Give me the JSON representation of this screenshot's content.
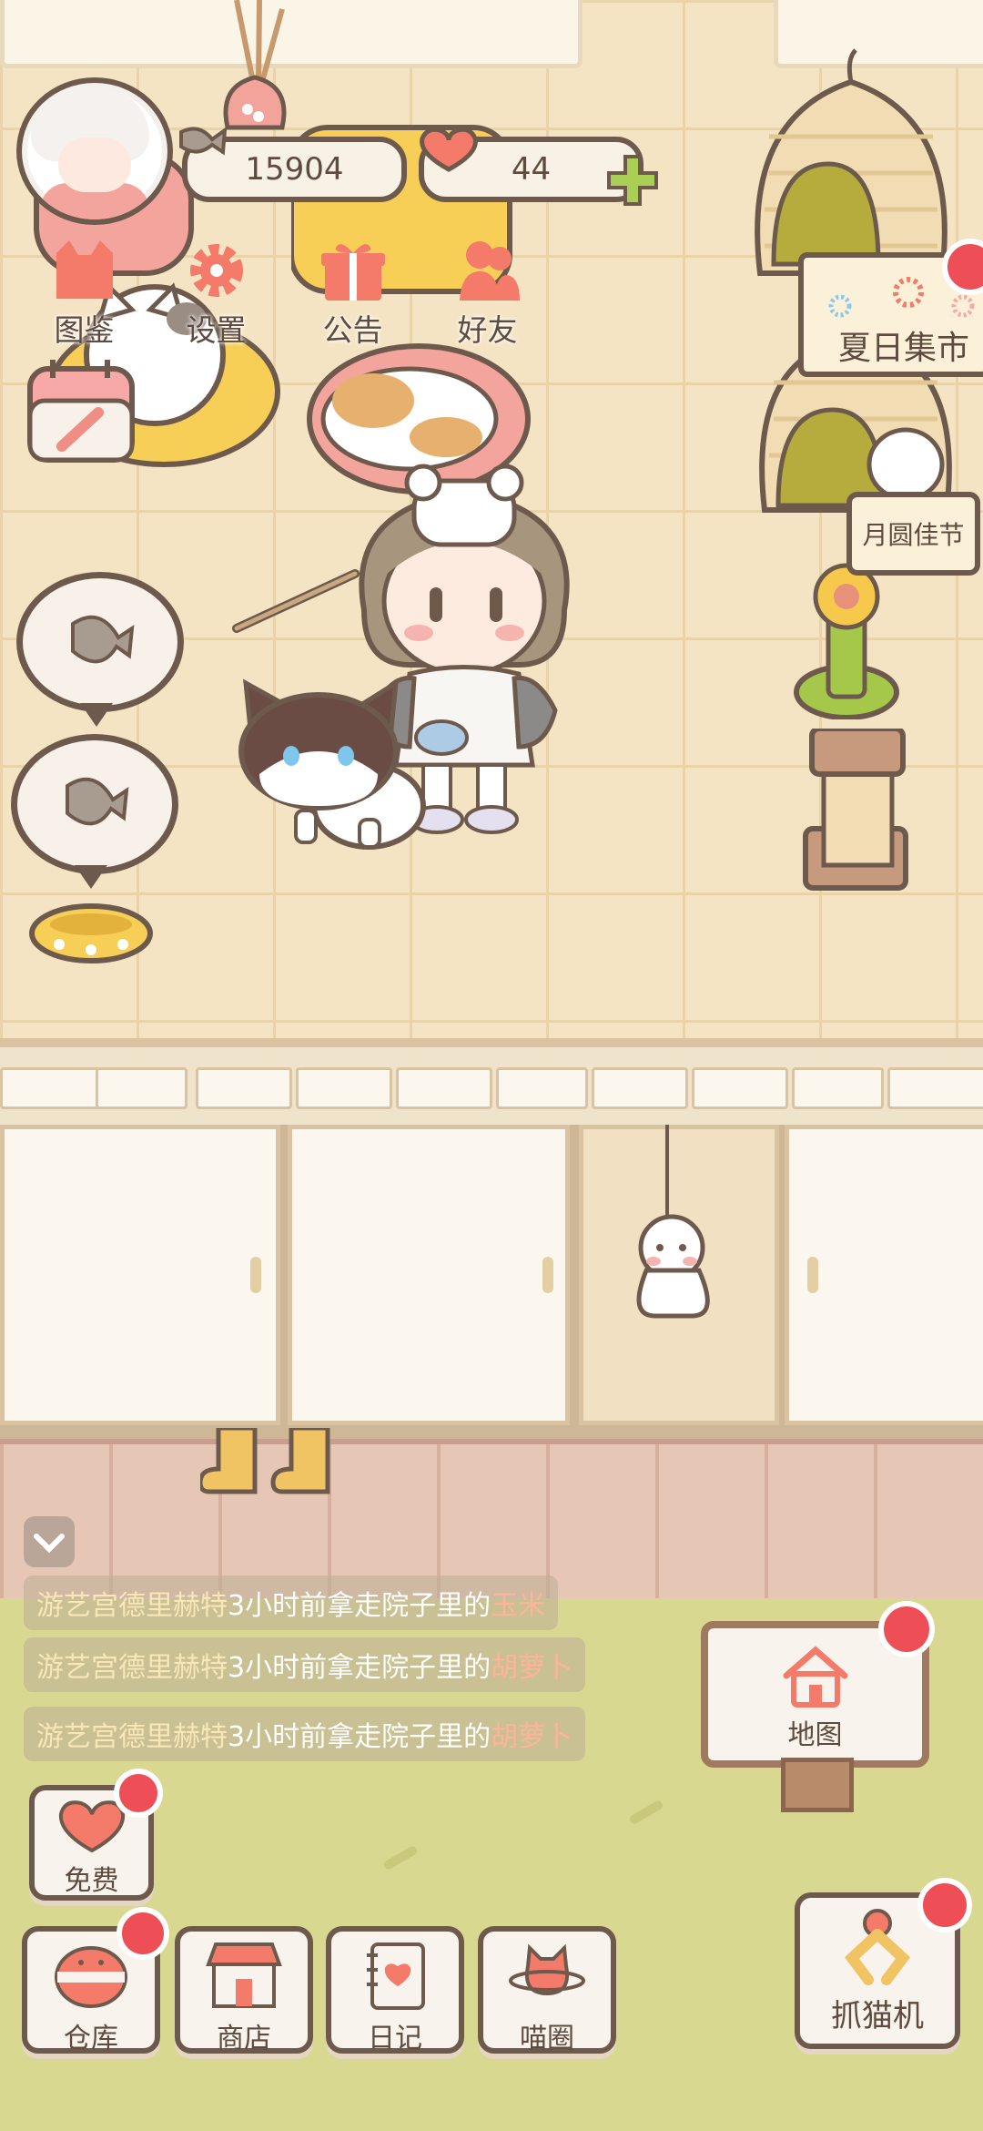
{
  "hud": {
    "fish_count": "15904",
    "heart_count": "44",
    "menu": [
      {
        "label": "图鉴",
        "icon": "cat-book-icon"
      },
      {
        "label": "设置",
        "icon": "gear-icon"
      },
      {
        "label": "公告",
        "icon": "gift-icon"
      },
      {
        "label": "好友",
        "icon": "friends-icon"
      }
    ]
  },
  "events": {
    "summer_market": "夏日集市",
    "mid_autumn": "月圆佳节"
  },
  "feed": [
    {
      "name": "游艺宫德里赫特",
      "action": "3小时前拿走院子里的",
      "item": "玉米"
    },
    {
      "name": "游艺宫德里赫特",
      "action": "3小时前拿走院子里的",
      "item": "胡萝卜"
    },
    {
      "name": "游艺宫德里赫特",
      "action": "3小时前拿走院子里的",
      "item": "胡萝卜"
    }
  ],
  "bottom": {
    "free": "免费",
    "warehouse": "仓库",
    "shop": "商店",
    "diary": "日记",
    "circle": "喵圈",
    "claw": "抓猫机",
    "map": "地图"
  },
  "colors": {
    "outline": "#6e5a4c",
    "accent_red": "#ee4e55",
    "icon_coral": "#f47a6a",
    "plus_green": "#a9cf54",
    "garden": "#d8d890"
  }
}
